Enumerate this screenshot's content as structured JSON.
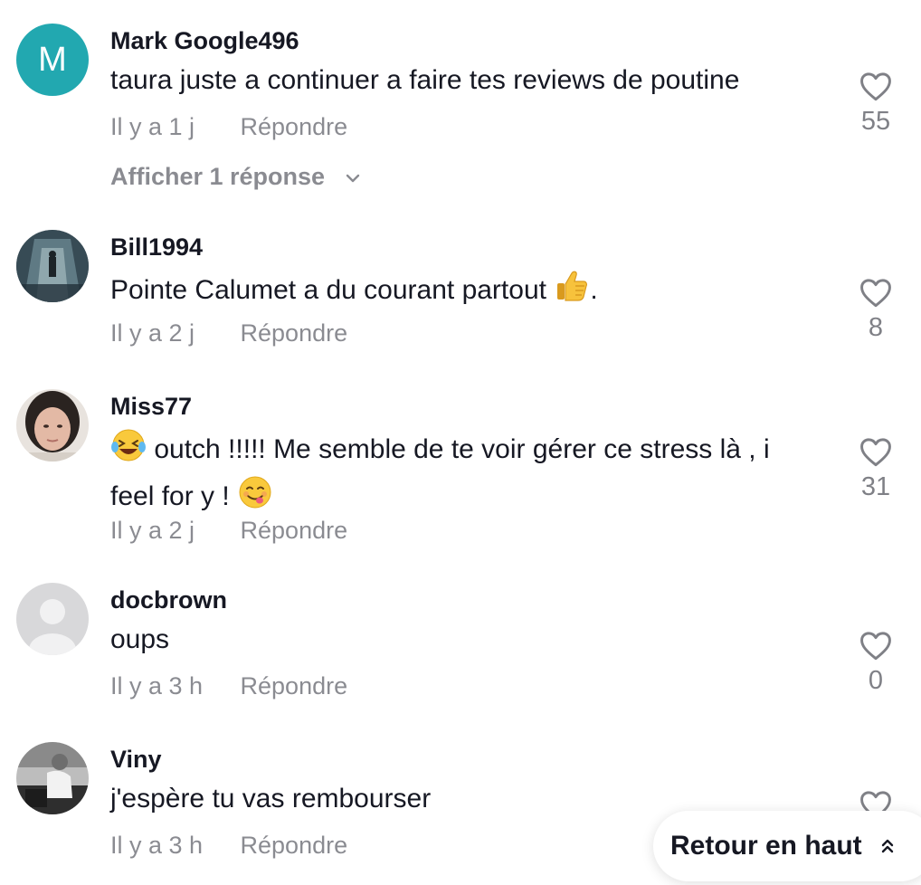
{
  "comments": [
    {
      "username": "Mark Google496",
      "avatar_letter": "M",
      "avatar_color": "#22a8b0",
      "text": "taura juste a continuer a faire tes reviews de poutine",
      "time": "Il y a 1 j",
      "reply_label": "Répondre",
      "likes": "55",
      "view_replies_label": "Afficher 1 réponse"
    },
    {
      "username": "Bill1994",
      "text": "Pointe Calumet a du courant partout",
      "text_suffix": ".",
      "emoji": "thumbs-up-emoji",
      "time": "Il y a 2 j",
      "reply_label": "Répondre",
      "likes": "8"
    },
    {
      "username": "Miss77",
      "emoji_leading": "laughing-tears-emoji",
      "text": " outch !!!!! Me semble de te voir gérer ce stress là , i feel for y ! ",
      "emoji_trailing": "savoring-face-emoji",
      "time": "Il y a 2 j",
      "reply_label": "Répondre",
      "likes": "31"
    },
    {
      "username": "docbrown",
      "text": "oups",
      "time": "Il y a 3 h",
      "reply_label": "Répondre",
      "likes": "0"
    },
    {
      "username": "Viny",
      "text": "j'espère tu vas rembourser",
      "time": "Il y a 3 h",
      "reply_label": "Répondre"
    }
  ],
  "back_to_top": {
    "label": "Retour en haut",
    "icon": "double-chevron-up-icon"
  },
  "colors": {
    "text_primary": "#161823",
    "text_secondary": "rgba(22,24,35,0.5)",
    "avatar_letter_bg": "#22a8b0"
  }
}
